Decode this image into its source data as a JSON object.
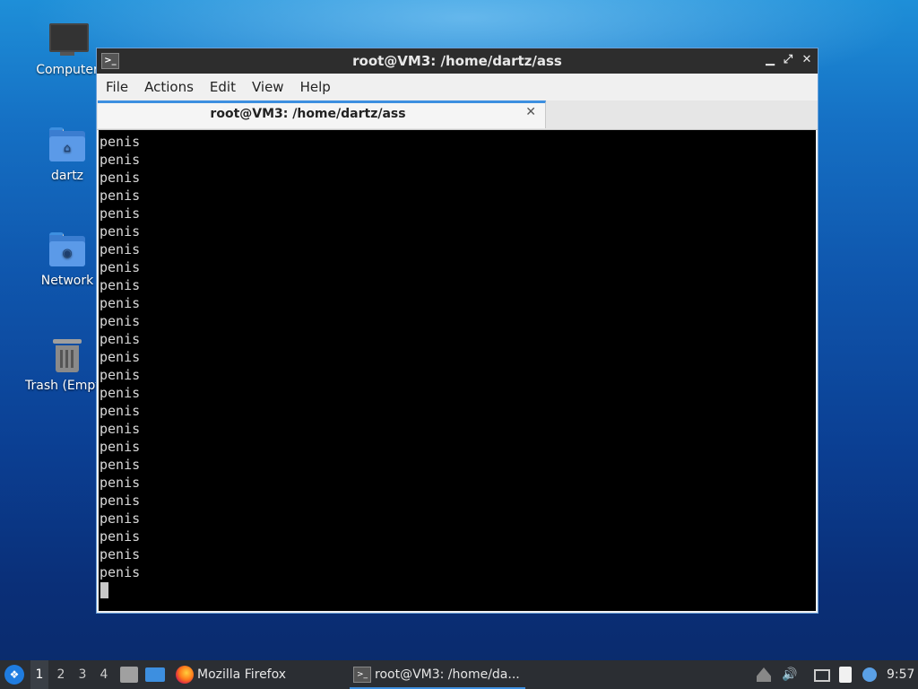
{
  "desktop": {
    "icons": [
      {
        "label": "Computer",
        "icon": "computer-icon"
      },
      {
        "label": "dartz",
        "icon": "home-folder-icon"
      },
      {
        "label": "Network",
        "icon": "network-folder-icon"
      },
      {
        "label": "Trash (Empty)",
        "icon": "trash-icon"
      }
    ]
  },
  "window": {
    "title": "root@VM3: /home/dartz/ass",
    "controls": {
      "minimize": "▁",
      "maximize": "⤢",
      "close": "✕"
    },
    "menu": [
      "File",
      "Actions",
      "Edit",
      "View",
      "Help"
    ],
    "tab": {
      "title": "root@VM3: /home/dartz/ass",
      "close": "✕"
    },
    "terminal_lines": [
      "penis",
      "penis",
      "penis",
      "penis",
      "penis",
      "penis",
      "penis",
      "penis",
      "penis",
      "penis",
      "penis",
      "penis",
      "penis",
      "penis",
      "penis",
      "penis",
      "penis",
      "penis",
      "penis",
      "penis",
      "penis",
      "penis",
      "penis",
      "penis",
      "penis"
    ]
  },
  "taskbar": {
    "workspaces": [
      "1",
      "2",
      "3",
      "4"
    ],
    "active_workspace": "1",
    "firefox_label": "Mozilla Firefox",
    "terminal_task_label": "root@VM3: /home/da...",
    "clock": "9:57"
  }
}
